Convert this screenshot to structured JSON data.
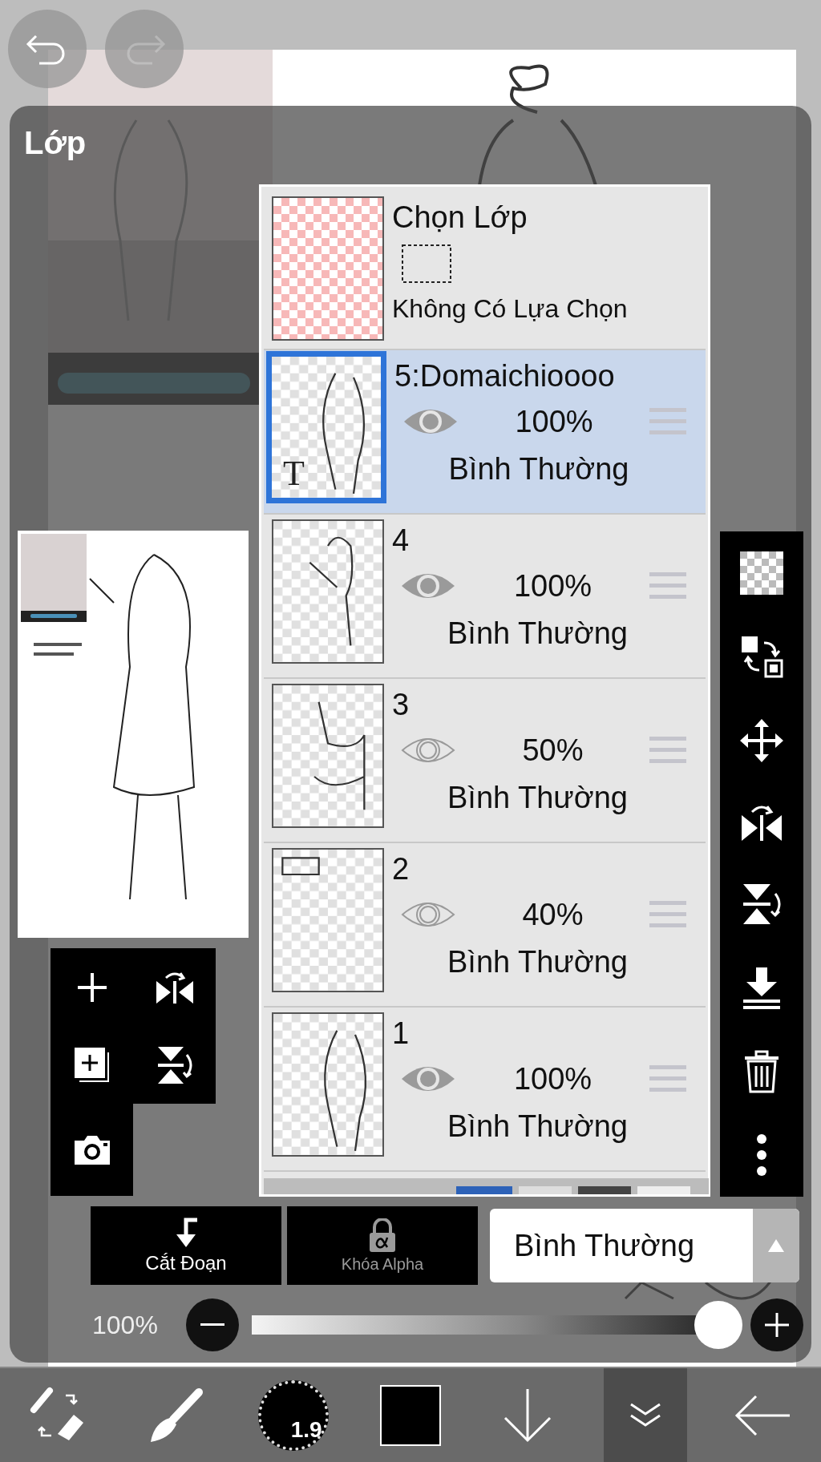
{
  "undo": {
    "disabled": false
  },
  "redo": {
    "disabled": true
  },
  "panel": {
    "title": "Lớp"
  },
  "selection_row": {
    "title": "Chọn Lớp",
    "status": "Không Có Lựa Chọn"
  },
  "layers": [
    {
      "name": "5:Domaichioooo",
      "badge": "T",
      "visible": true,
      "opacity": "100%",
      "blend": "Bình Thường",
      "selected": true
    },
    {
      "name": "4",
      "visible": true,
      "opacity": "100%",
      "blend": "Bình Thường",
      "selected": false
    },
    {
      "name": "3",
      "visible": false,
      "opacity": "50%",
      "blend": "Bình Thường",
      "selected": false
    },
    {
      "name": "2",
      "visible": false,
      "opacity": "40%",
      "blend": "Bình Thường",
      "selected": false
    },
    {
      "name": "1",
      "visible": true,
      "opacity": "100%",
      "blend": "Bình Thường",
      "selected": false
    }
  ],
  "clipping_button": {
    "label": "Cắt Đoạn",
    "disabled": false
  },
  "alpha_lock_button": {
    "label": "Khóa Alpha",
    "disabled": true
  },
  "blend_mode_select": {
    "value": "Bình Thường"
  },
  "opacity": {
    "reading": "100%",
    "level": 1
  },
  "toolbar": [
    {
      "kind": "swap",
      "selected": false
    },
    {
      "kind": "brush",
      "selected": false
    },
    {
      "kind": "size",
      "label": "1.9",
      "selected": false
    },
    {
      "kind": "color",
      "selected": false
    },
    {
      "kind": "down",
      "selected": false
    },
    {
      "kind": "layers",
      "selected": true
    },
    {
      "kind": "back",
      "selected": false
    }
  ]
}
